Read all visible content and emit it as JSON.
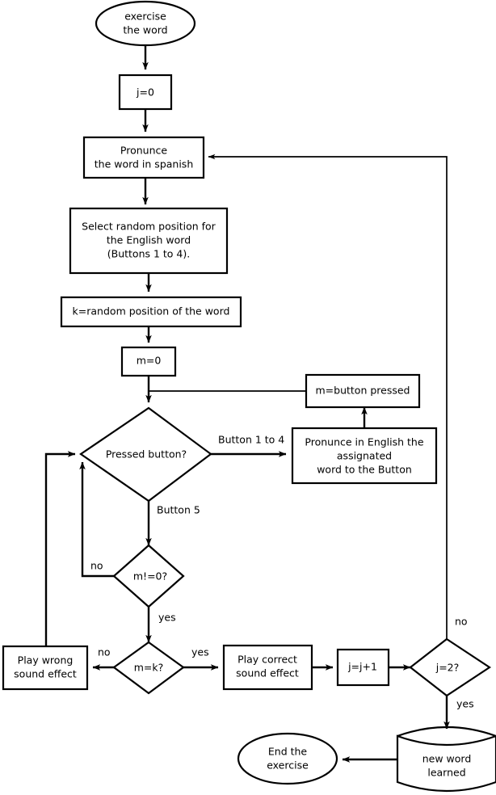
{
  "diagram": {
    "title": "exercise the word flowchart",
    "background_color": "#ffffff",
    "stroke_color": "#000000",
    "nodes": {
      "start": {
        "label_line1": "exercise",
        "label_line2": "the word",
        "shape": "ellipse"
      },
      "j_init": {
        "label": "j=0",
        "shape": "process"
      },
      "pronounce_spanish": {
        "label_line1": "Pronunce",
        "label_line2": "the word in spanish",
        "shape": "process"
      },
      "select_random": {
        "label_line1": "Select random position for",
        "label_line2": "the English word",
        "label_line3": "(Buttons 1 to 4).",
        "shape": "process"
      },
      "k_random": {
        "label": "k=random position of the word",
        "shape": "process"
      },
      "m_init": {
        "label": "m=0",
        "shape": "process"
      },
      "pressed_button": {
        "label": "Pressed button?",
        "shape": "decision"
      },
      "m_button_pressed": {
        "label": "m=button pressed",
        "shape": "process"
      },
      "pronounce_english": {
        "label_line1": "Pronunce in English the",
        "label_line2": "assignated",
        "label_line3": "word to the Button",
        "shape": "process"
      },
      "m_not_zero": {
        "label": "m!=0?",
        "shape": "decision"
      },
      "m_equals_k": {
        "label": "m=k?",
        "shape": "decision"
      },
      "play_wrong": {
        "label_line1": "Play wrong",
        "label_line2": "sound effect",
        "shape": "process"
      },
      "play_correct": {
        "label_line1": "Play correct",
        "label_line2": "sound effect",
        "shape": "process"
      },
      "j_increment": {
        "label": "j=j+1",
        "shape": "process"
      },
      "j_equals_two": {
        "label": "j=2?",
        "shape": "decision"
      },
      "new_word_learned": {
        "label_line1": "new word",
        "label_line2": "learned",
        "shape": "cylinder"
      },
      "end": {
        "label_line1": "End the",
        "label_line2": "exercise",
        "shape": "ellipse"
      }
    },
    "edge_labels": {
      "button_1_to_4": "Button 1 to 4",
      "button_5": "Button 5",
      "m_not_zero_no": "no",
      "m_not_zero_yes": "yes",
      "m_equals_k_no": "no",
      "m_equals_k_yes": "yes",
      "j_equals_two_no": "no",
      "j_equals_two_yes": "yes"
    }
  }
}
